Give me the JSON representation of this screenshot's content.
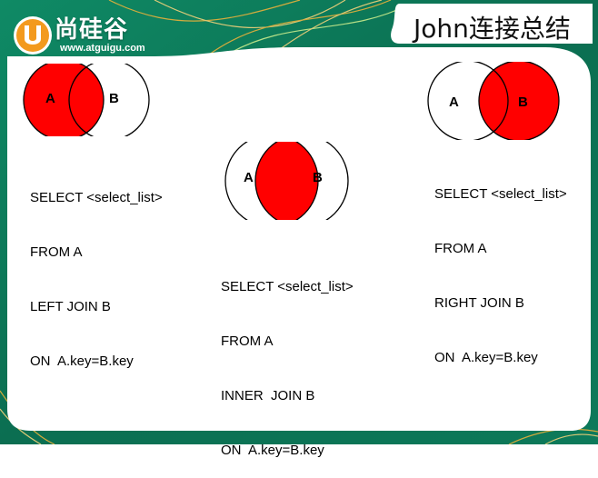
{
  "header": {
    "brand_name": "尚硅谷",
    "brand_url": "www.atguigu.com",
    "logo_letter": "U",
    "title": "John连接总结"
  },
  "colors": {
    "highlight": "#ff0000",
    "frame_green": "#0e7f5e",
    "frame_dark": "#0a5e45",
    "gold": "#e9b13a",
    "logo_orange": "#f39a1e"
  },
  "diagrams": {
    "left": {
      "label_a": "A",
      "label_b": "B",
      "highlight": "A",
      "sql": [
        "SELECT <select_list>",
        "FROM A",
        "LEFT JOIN B",
        "ON  A.key=B.key"
      ]
    },
    "inner": {
      "label_a": "A",
      "label_b": "B",
      "highlight": "intersection",
      "sql": [
        "SELECT <select_list>",
        "FROM A",
        "INNER  JOIN B",
        "ON  A.key=B.key"
      ]
    },
    "right": {
      "label_a": "A",
      "label_b": "B",
      "highlight": "B",
      "sql": [
        "SELECT <select_list>",
        "FROM A",
        "RIGHT JOIN B",
        "ON  A.key=B.key"
      ]
    }
  }
}
